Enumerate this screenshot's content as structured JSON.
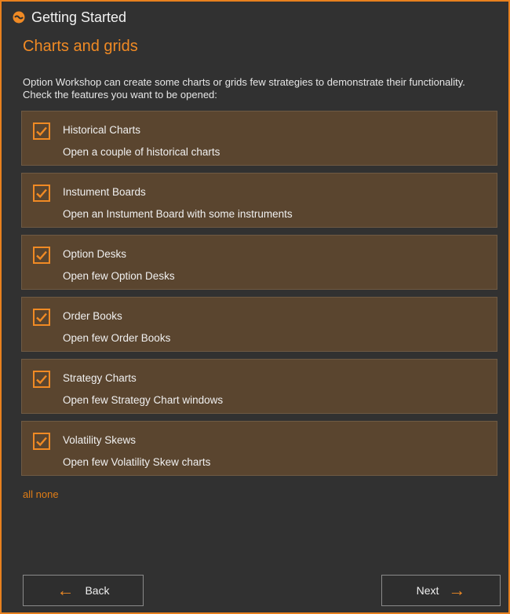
{
  "window": {
    "title": "Getting Started"
  },
  "page": {
    "section_title": "Charts and grids",
    "description": "Option Workshop can create some charts or grids few strategies to demonstrate their functionality. Check the features you want to be opened:"
  },
  "options": [
    {
      "title": "Historical Charts",
      "subtitle": "Open a couple of historical charts",
      "checked": true
    },
    {
      "title": "Instument Boards",
      "subtitle": "Open an Instument Board with some instruments",
      "checked": true
    },
    {
      "title": "Option Desks",
      "subtitle": "Open few Option Desks",
      "checked": true
    },
    {
      "title": "Order Books",
      "subtitle": "Open few Order Books",
      "checked": true
    },
    {
      "title": "Strategy Charts",
      "subtitle": "Open few Strategy Chart windows",
      "checked": true
    },
    {
      "title": "Volatility Skews",
      "subtitle": "Open few Volatility Skew charts",
      "checked": true
    }
  ],
  "links": {
    "all": "all",
    "none": "none"
  },
  "buttons": {
    "back": "Back",
    "next": "Next"
  },
  "colors": {
    "accent": "#f08a24",
    "panel": "#5a452f",
    "background": "#313131"
  },
  "icons": {
    "app": "app-logo-icon",
    "check": "checkmark-icon",
    "back": "arrow-left-icon",
    "next": "arrow-right-icon"
  }
}
